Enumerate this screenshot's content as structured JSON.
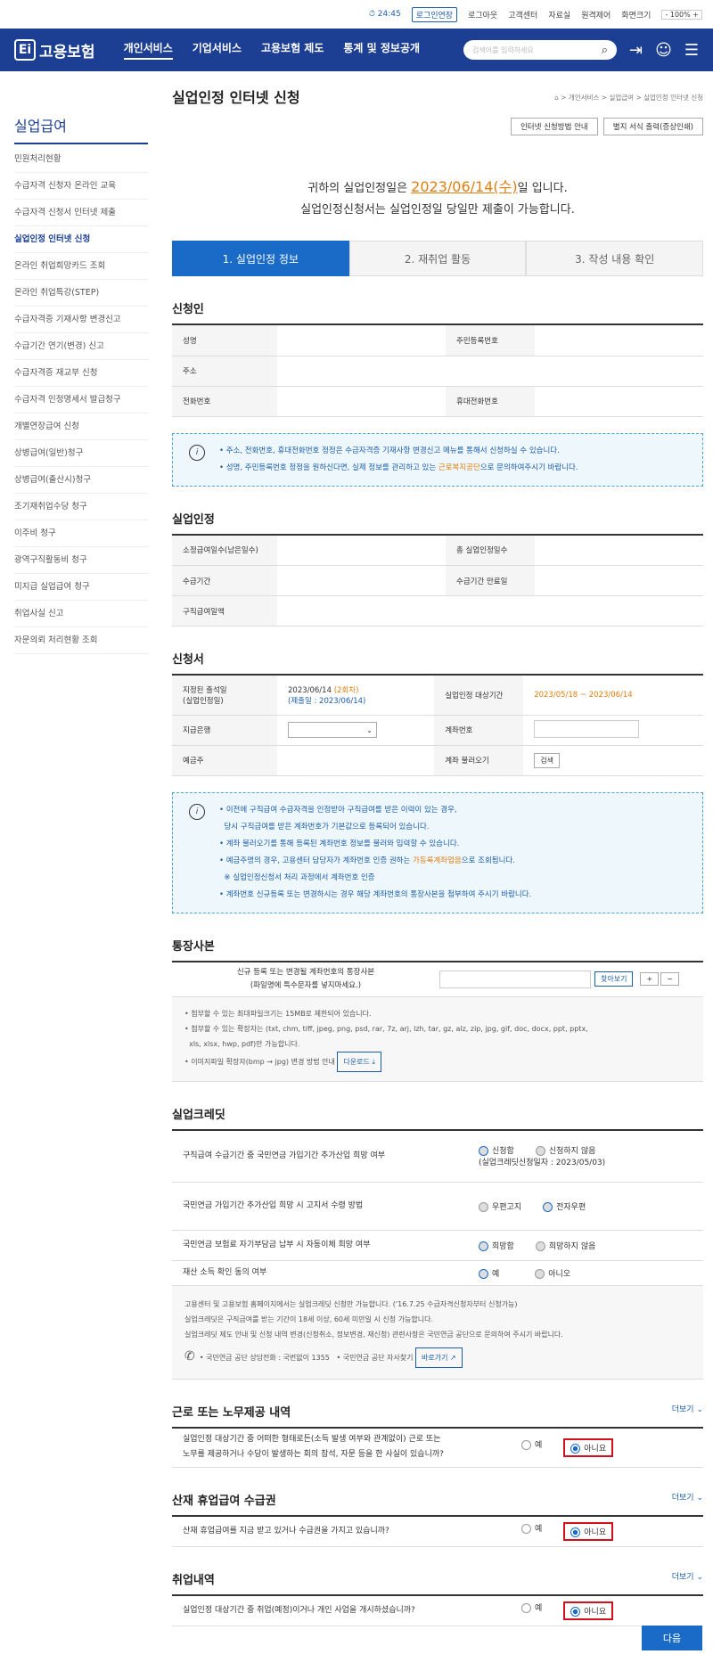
{
  "topbar": {
    "timer": "24:45",
    "extend": "로그인연장",
    "logout": "로그아웃",
    "center": "고객센터",
    "data": "자료실",
    "sitemap": "원격제어",
    "screen": "화면크기",
    "zoom": "100%"
  },
  "gnb": {
    "logo": "고용보험",
    "menus": [
      "개인서비스",
      "기업서비스",
      "고용보험 제도",
      "통계 및 정보공개"
    ],
    "search_placeholder": "검색어를 입력하세요"
  },
  "side": {
    "title": "실업급여",
    "items": [
      "민원처리현황",
      "수급자격 신청자 온라인 교육",
      "수급자격 신청서 인터넷 제출",
      "실업인정 인터넷 신청",
      "온라인 취업희망카드 조회",
      "온라인 취업특강(STEP)",
      "수급자격증 기재사항 변경신고",
      "수급기간 연기(변경) 신고",
      "수급자격증 재교부 신청",
      "수급자격 인정명세서 발급청구",
      "개별연장급여 신청",
      "상병급여(일반)청구",
      "상병급여(출산시)청구",
      "조기재취업수당 청구",
      "이주비 청구",
      "광역구직활동비 청구",
      "미지급 실업급여 청구",
      "취업사실 신고",
      "자문의뢰 처리현황 조회"
    ]
  },
  "page": {
    "title": "실업인정 인터넷 신청",
    "crumb": "⌂ > 개인서비스 > 실업급여 > 실업인정 인터넷 신청",
    "btn1": "인터넷 신청방법 안내",
    "btn2": "별지 서식 출력(증상인쇄)"
  },
  "notice": {
    "pre": "귀하의 실업인정일은 ",
    "date": "2023/06/14(수)",
    "post": "일 입니다.",
    "line2": "실업인정신청서는 실업인정일 당일만 제출이 가능합니다."
  },
  "steps": [
    "1. 실업인정 정보",
    "2. 재취업 활동",
    "3. 작성 내용 확인"
  ],
  "applicant": {
    "title": "신청인",
    "name": "성명",
    "rrn": "주민등록번호",
    "address": "주소",
    "phone": "전화번호",
    "mobile": "휴대전화번호"
  },
  "info1": {
    "l1": "주소, 전화번호, 휴대전화번호 정정은 수급자격증 기재사항 변경신고 메뉴를 통해서 신청하실 수 있습니다.",
    "l2a": "성명, 주민등록번호 정정을 원하신다면, 실제 정보를 관리하고 있는 ",
    "l2b": "근로복지공단",
    "l2c": "으로 문의하여주시기 바랍니다."
  },
  "recog": {
    "title": "실업인정",
    "remain": "소정급여일수(남은일수)",
    "total": "총 실업인정일수",
    "period": "수급기간",
    "enddate": "수급기간 만료일",
    "daily": "구직급여일액"
  },
  "apply": {
    "title": "신청서",
    "attend": "지정된 출석일",
    "attend2": "(실업인정일)",
    "date": "2023/06/14 ",
    "round": "(2회차)",
    "submit": "(제출일 : 2023/06/14)",
    "target": "실업인정 대상기간",
    "range": "2023/05/18 ~ 2023/06/14",
    "bank": "지급은행",
    "account": "계좌번호",
    "holder": "예금주",
    "load": "계좌 불러오기",
    "search": "검색"
  },
  "info2": [
    "이전에 구직급여 수급자격을 인정받아 구직급여를 받은 이력이 있는 경우,",
    "당시 구직급여를 받은 계좌번호가 기본값으로 등록되어 있습니다.",
    "계좌 불러오기를 통해 등록된 계좌번호 정보를 불러와 입력할 수 있습니다.",
    "예금주명의 경우, 고용센터 담당자가 계좌번호 인증 권하는 ",
    "가동록계좌업음",
    "으로 조회됩니다.",
    "※ 실업인정신청서 처리 과정에서 계좌번호 인증",
    "계좌번호 신규등록 또는 변경하시는 경우 해당 계좌번호의 통장사본을 첨부하여 주시기 바랍니다."
  ],
  "passbook": {
    "title": "통장사본",
    "label1": "신규 등록 또는 변경될 계좌번호의 통장사본",
    "label2": "(파일명에 특수문자를 넣지마세요.)",
    "browse": "찾아보기",
    "n1": "첨부할 수 있는 최대파일크기는 15MB로 제한되어 있습니다.",
    "n2": "첨부할 수 있는 확장자는 (txt, chm, tiff, jpeg, png, psd, rar, 7z, arj, lzh, tar, gz, alz, zip, jpg, gif, doc, docx, ppt, pptx,",
    "n3": "xls, xlsx, hwp, pdf)만 가능합니다.",
    "n4": "이미지파일 확장자(bmp → jpg) 변경 방법 안내",
    "download": "다운로드 ⤓"
  },
  "credit": {
    "title": "실업크레딧",
    "q1": "구직급여 수급기간 중 국민연금 가입기간 추가산입 희망 여부",
    "q1a": "신청함",
    "q1b": "신청하지 않음",
    "q1c": "(실업크레딧신청일자 : 2023/05/03)",
    "q2": "국민연금 가입기간 추가산입 희망 시 고지서 수령 방법",
    "q2a": "우편고지",
    "q2b": "전자우편",
    "q3": "국민연금 보험료 자기부담금 납부 시 자동이체 희망 여부",
    "q3a": "희망함",
    "q3b": "희망하지 않음",
    "q4": "재산 소득 확인 동의 여부",
    "q4a": "예",
    "q4b": "아니오",
    "n1": "고용센터 및 고용보험 홈페이지에서는 실업크레딧 신청만 가능합니다. ('16.7.25 수급자격신청자부터 신청가능)",
    "n2": "실업크레딧은 구직급여를 받는 기간이 18세 이상, 60세 미만일 시 신청 가능합니다.",
    "n3": "실업크레딧 제도 안내 및 신청 내역 변경(신청취소, 정보변경, 재신청) 관련사항은 국민연금 공단으로 문의하여 주시기 바랍니다.",
    "tel": "국민연금 공단 상담전화 : 국번없이 1355",
    "site": "국민연금 공단 자사찾기",
    "go": "바로가기 ↗"
  },
  "work": {
    "title": "근로 또는 노무제공 내역",
    "more": "더보기 ⌄",
    "q": "실업인정 대상기간 중 어떠한 형태로든(소득 발생 여부와 관계없이) 근로 또는",
    "q2": "노무를 제공하거나 수당이 발생하는 회의 참석, 자문 등을 한 사실이 있습니까?",
    "yes": "예",
    "no": "아니요"
  },
  "injury": {
    "title": "산재 휴업급여 수급권",
    "more": "더보기 ⌄",
    "q": "산재 휴업급여를 지금 받고 있거나 수급권을 가지고 있습니까?",
    "yes": "예",
    "no": "아니요"
  },
  "job": {
    "title": "취업내역",
    "more": "더보기 ⌄",
    "q": "실업인정 대상기간 중 취업(예정)이거나 개인 사업을 개시하셨습니까?",
    "yes": "예",
    "no": "아니요"
  },
  "next": "다음"
}
